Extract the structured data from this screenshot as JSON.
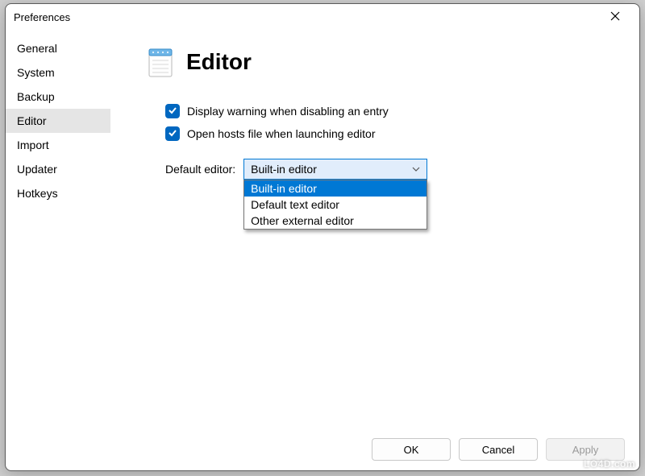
{
  "window": {
    "title": "Preferences"
  },
  "sidebar": {
    "items": [
      {
        "label": "General"
      },
      {
        "label": "System"
      },
      {
        "label": "Backup"
      },
      {
        "label": "Editor"
      },
      {
        "label": "Import"
      },
      {
        "label": "Updater"
      },
      {
        "label": "Hotkeys"
      }
    ],
    "selected_index": 3
  },
  "page": {
    "title": "Editor",
    "checkbox1_label": "Display warning when disabling an entry",
    "checkbox1_checked": true,
    "checkbox2_label": "Open hosts file when launching editor",
    "checkbox2_checked": true,
    "default_editor_label": "Default editor:",
    "default_editor_value": "Built-in editor",
    "default_editor_options": [
      "Built-in editor",
      "Default text editor",
      "Other external editor"
    ],
    "dropdown_highlight_index": 0
  },
  "buttons": {
    "ok": "OK",
    "cancel": "Cancel",
    "apply": "Apply"
  },
  "watermark": "LO4D.com"
}
